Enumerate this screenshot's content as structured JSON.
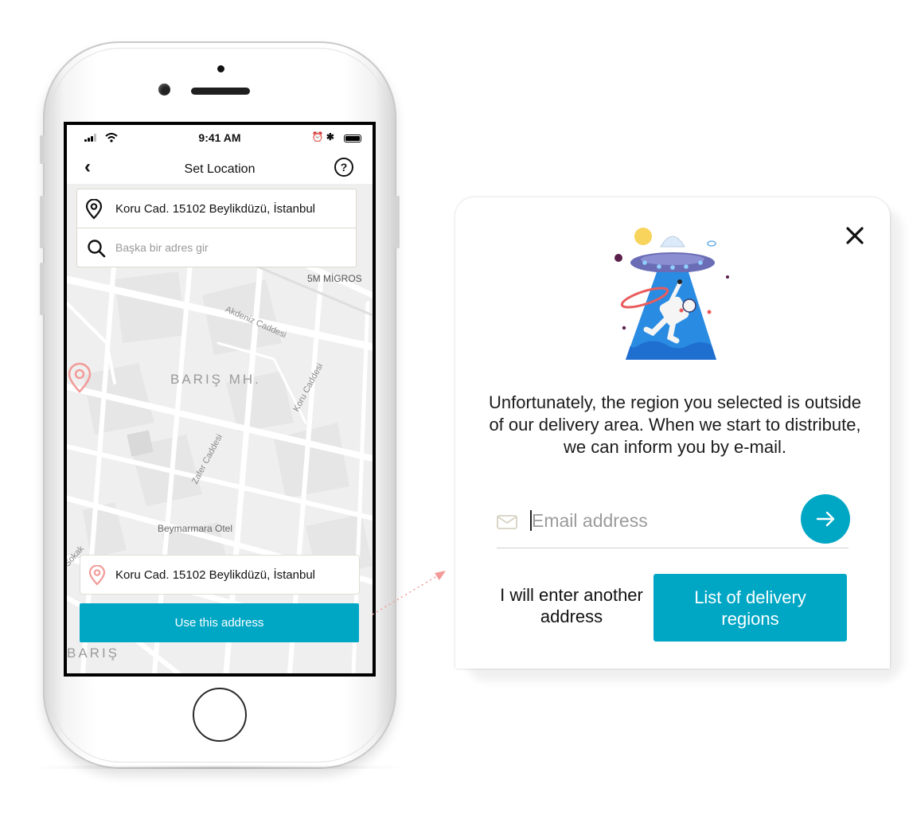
{
  "status_bar": {
    "time": "9:41 AM"
  },
  "nav": {
    "back_icon": "chevron-left-icon",
    "title": "Set Location",
    "help_icon": "question-circle-icon"
  },
  "search": {
    "current_address": "Koru Cad. 15102 Beylikdüzü, İstanbul",
    "placeholder": "Başka bir adres gir"
  },
  "map": {
    "labels": {
      "migros": "5M MİGROS",
      "akdeniz": "Akdeniz Caddesi",
      "baris_mh": "BARIŞ MH.",
      "koru": "Koru Caddesi",
      "zafer": "Zafer Caddesi",
      "otel": "Beymarmara Otel",
      "sokak": "Sokak",
      "baris": "BARIŞ"
    },
    "pin_color": "#f29b98"
  },
  "bottom": {
    "selected_address": "Koru Cad. 15102 Beylikdüzü, İstanbul",
    "use_button": "Use this address"
  },
  "modal": {
    "message": "Unfortunately, the region you selected is outside of our delivery area. When we start to distribute, we can inform you by e-mail.",
    "email_placeholder": "Email address",
    "other_address": "I will enter another address",
    "delivery_regions": "List of delivery regions"
  },
  "colors": {
    "accent": "#00a7c5",
    "pin": "#f29b98"
  }
}
